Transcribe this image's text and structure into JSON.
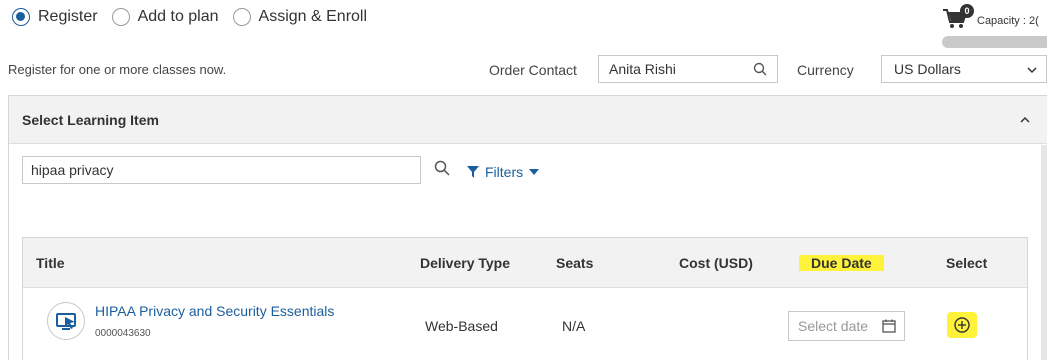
{
  "mode_options": [
    {
      "label": "Register",
      "checked": true
    },
    {
      "label": "Add to plan",
      "checked": false
    },
    {
      "label": "Assign & Enroll",
      "checked": false
    }
  ],
  "cart": {
    "count": "0",
    "capacity_text": "Capacity : 2("
  },
  "register_text": "Register for one or more classes now.",
  "order_contact": {
    "label": "Order Contact",
    "value": "Anita Rishi"
  },
  "currency": {
    "label": "Currency",
    "value": "US Dollars"
  },
  "panel": {
    "title": "Select Learning Item"
  },
  "search": {
    "value": "hipaa privacy"
  },
  "filters_label": "Filters",
  "table": {
    "headers": {
      "title": "Title",
      "delivery": "Delivery Type",
      "seats": "Seats",
      "cost": "Cost (USD)",
      "due": "Due Date",
      "select": "Select"
    },
    "rows": [
      {
        "title": "HIPAA Privacy and Security Essentials",
        "code": "0000043630",
        "delivery": "Web-Based",
        "seats": "N/A",
        "date_placeholder": "Select date"
      }
    ]
  },
  "colors": {
    "accent": "#1b5e9e",
    "highlight": "#fff23a"
  }
}
